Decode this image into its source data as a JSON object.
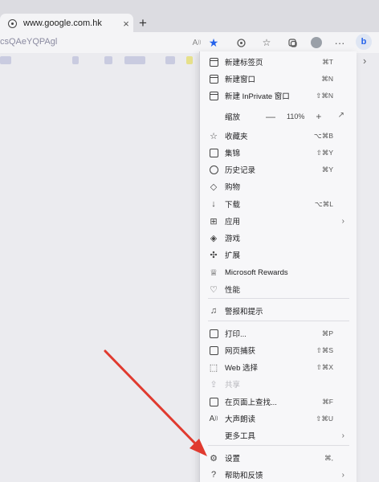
{
  "browser": {
    "tab_title": "www.google.com.hk",
    "tab_close": "×",
    "new_tab": "+",
    "url_fragment": "csQAeYQPAgl"
  },
  "menu": {
    "items": [
      {
        "label": "新建标签页",
        "shortcut": "⌘T",
        "icon": "new-tab-icon"
      },
      {
        "label": "新建窗口",
        "shortcut": "⌘N",
        "icon": "new-window-icon"
      },
      {
        "label": "新建 InPrivate 窗口",
        "shortcut": "⇧⌘N",
        "icon": "inprivate-icon"
      },
      {
        "label": "缩放",
        "icon": "zoom"
      },
      {
        "label": "收藏夹",
        "shortcut": "⌥⌘B",
        "icon": "favorites-icon"
      },
      {
        "label": "集锦",
        "shortcut": "⇧⌘Y",
        "icon": "collections-icon"
      },
      {
        "label": "历史记录",
        "shortcut": "⌘Y",
        "icon": "history-icon"
      },
      {
        "label": "购物",
        "icon": "shopping-icon"
      },
      {
        "label": "下载",
        "shortcut": "⌥⌘L",
        "icon": "download-icon"
      },
      {
        "label": "应用",
        "icon": "apps-icon",
        "submenu": true
      },
      {
        "label": "游戏",
        "icon": "games-icon"
      },
      {
        "label": "扩展",
        "icon": "extensions-icon"
      },
      {
        "label": "Microsoft Rewards",
        "icon": "rewards-icon"
      },
      {
        "label": "性能",
        "icon": "performance-icon"
      },
      {
        "label": "警报和提示",
        "icon": "alerts-icon"
      },
      {
        "label": "打印...",
        "shortcut": "⌘P",
        "icon": "print-icon"
      },
      {
        "label": "网页捕获",
        "shortcut": "⇧⌘S",
        "icon": "web-capture-icon"
      },
      {
        "label": "Web 选择",
        "shortcut": "⇧⌘X",
        "icon": "web-select-icon"
      },
      {
        "label": "共享",
        "icon": "share-icon",
        "disabled": true
      },
      {
        "label": "在页面上查找...",
        "shortcut": "⌘F",
        "icon": "find-icon"
      },
      {
        "label": "大声朗读",
        "shortcut": "⇧⌘U",
        "icon": "read-aloud-icon"
      },
      {
        "label": "更多工具",
        "icon": "more-tools-icon",
        "submenu": true
      },
      {
        "label": "设置",
        "shortcut": "⌘,",
        "icon": "settings-icon"
      },
      {
        "label": "帮助和反馈",
        "icon": "help-icon",
        "submenu": true
      }
    ],
    "zoom": {
      "minus": "—",
      "value": "110%",
      "plus": "+"
    }
  },
  "colors": {
    "accent": "#2563eb",
    "arrow": "#e03a2f"
  }
}
